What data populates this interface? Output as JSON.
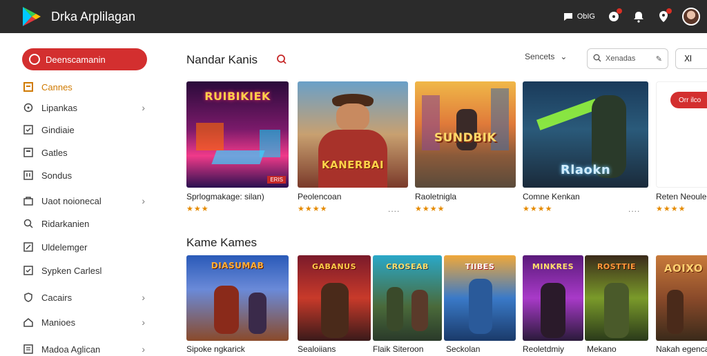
{
  "header": {
    "title": "Drka Arplilagan",
    "chat_label": "ObIG"
  },
  "sidebar": {
    "primary_button": "Deenscamanin",
    "items": [
      {
        "label": "Cannes",
        "icon": "grid-icon",
        "chevron": false
      },
      {
        "label": "Lipankas",
        "icon": "compass-icon",
        "chevron": true
      },
      {
        "label": "Gindiaie",
        "icon": "check-icon",
        "chevron": false
      },
      {
        "label": "Gatles",
        "icon": "square-icon",
        "chevron": false
      },
      {
        "label": "Sondus",
        "icon": "note-icon",
        "chevron": false
      },
      {
        "label": "Uaot noionecal",
        "icon": "bag-icon",
        "chevron": true
      },
      {
        "label": "Ridarkanien",
        "icon": "search-icon",
        "chevron": false
      },
      {
        "label": "Uldelemger",
        "icon": "edit-icon",
        "chevron": false
      },
      {
        "label": "Sypken Carlesl",
        "icon": "check-box-icon",
        "chevron": false
      },
      {
        "label": "Cacairs",
        "icon": "shield-icon",
        "chevron": true
      },
      {
        "label": "Manioes",
        "icon": "home-icon",
        "chevron": true
      },
      {
        "label": "Madoa Aglican",
        "icon": "doc-icon",
        "chevron": true
      }
    ]
  },
  "toolbar": {
    "sort_label": "Sencets",
    "search_placeholder": "Xenadas",
    "filter_label": "Ⅺ"
  },
  "section1": {
    "title": "Nandar Kanis",
    "games": [
      {
        "title": "Sprlogmakage: silan)",
        "art_text": "RUIBIKIEK",
        "rating": "★★★",
        "more": "",
        "badge": "ERIS"
      },
      {
        "title": "Peolencoan",
        "art_text": "KANERBAI",
        "rating": "★★★★",
        "more": "",
        "badge": ""
      },
      {
        "title": "Raoletnigla",
        "art_text": "SUNDBIK",
        "rating": "★★★★",
        "more": "....",
        "badge": ""
      },
      {
        "title": "Comne Kenkan",
        "art_text": "Rlaokn",
        "rating": "★★★★",
        "more": "....",
        "badge": ""
      },
      {
        "title": "Reten Neoule",
        "art_text": "",
        "rating": "★★★★",
        "more": "",
        "badge": ""
      }
    ],
    "promo_button": "Orr ilco"
  },
  "section2": {
    "title": "Kame Kames",
    "games": [
      {
        "title": "Sipoke ngkarick",
        "art_text": "DIASUMAB"
      },
      {
        "title": "Sealoiians",
        "art_text": "GABANUS"
      },
      {
        "title": "Flaik Siteroon",
        "art_text": "CROSEAB"
      },
      {
        "title": "Seckolan",
        "art_text": "TIIBES"
      },
      {
        "title": "Reoletdmiy",
        "art_text": "MINKRES"
      },
      {
        "title": "Mekano",
        "art_text": "ROSTTIE"
      },
      {
        "title": "Nakah egenca",
        "art_text": "AOIXO"
      }
    ]
  },
  "colors": {
    "accent": "#d32f2f",
    "topbar": "#2b2b2b",
    "star": "#e58a00",
    "active_nav": "#d07a00"
  }
}
